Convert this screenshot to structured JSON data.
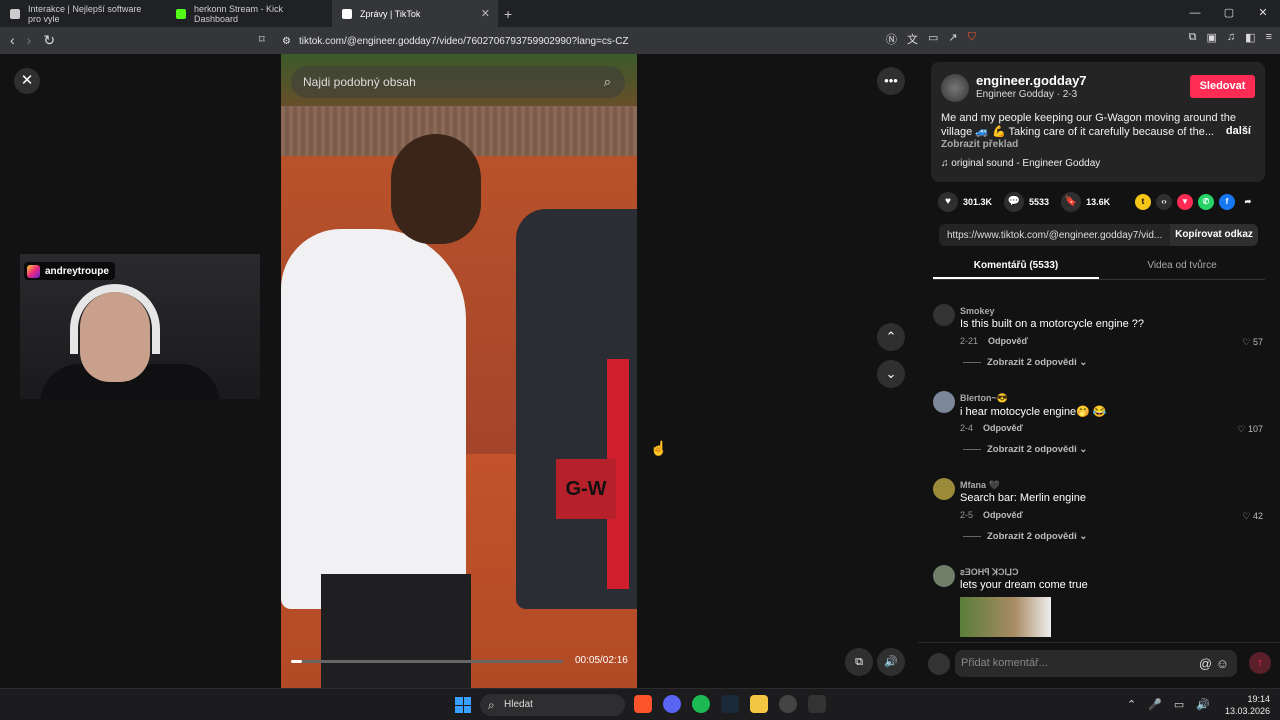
{
  "browser": {
    "tabs": [
      {
        "title": "Interakce | Nejlepší software pro vyle",
        "favicon_color": "#cccccc"
      },
      {
        "title": "herkonn Stream - Kick Dashboard",
        "favicon_color": "#53fc18"
      },
      {
        "title": "Zprávy | TikTok",
        "favicon_color": "#ffffff",
        "active": true
      }
    ],
    "new_tab": "+",
    "url": "tiktok.com/@engineer.godday7/video/7602706793759902990?lang=cs-CZ",
    "window_controls": [
      "—",
      "▢",
      "✕"
    ]
  },
  "video": {
    "search_placeholder": "Najdi podobný obsah",
    "time": "00:05/02:16",
    "progress": 0.04,
    "door_text": "G-W"
  },
  "webcam": {
    "handle": "andreytroupe"
  },
  "panel": {
    "username": "engineer.godday7",
    "subline": "Engineer Godday · 2-3",
    "follow_label": "Sledovat",
    "description": "Me and my people keeping our G-Wagon moving around the village 🚙 💪 Taking care of it carefully because of the...",
    "more_label": "další",
    "translate_label": "Zobrazit překlad",
    "sound": "original sound - Engineer Godday",
    "likes": "301.3K",
    "comments_count": "5533",
    "saves": "13.6K",
    "link": "https://www.tiktok.com/@engineer.godday7/vid...",
    "copy_label": "Kopírovat odkaz",
    "tab_comments": "Komentářů (5533)",
    "tab_creator": "Videa od tvůrce",
    "comment_placeholder": "Přidat komentář..."
  },
  "comments": [
    {
      "user": "Smokey",
      "text": "Is this built on a motorcycle engine ??",
      "date": "2-21",
      "reply": "Odpověď",
      "likes": "57",
      "replies": "Zobrazit 2 odpovědi"
    },
    {
      "user": "Blerton~😎",
      "text": "i hear motocycle engine🤭 😂",
      "date": "2-4",
      "reply": "Odpověď",
      "likes": "107",
      "replies": "Zobrazit 2 odpovědi"
    },
    {
      "user": "Mfana 🖤",
      "text": "Search bar: Merlin engine",
      "date": "2-5",
      "reply": "Odpověď",
      "likes": "42",
      "replies": "Zobrazit 2 odpovědi"
    },
    {
      "user": "ꙅƎOHꟼ ꓘƆI⅃Ɔ",
      "text": "lets your dream come true"
    }
  ],
  "taskbar": {
    "search_label": "Hledat",
    "time": "19:14",
    "date": "13.03.2026"
  }
}
